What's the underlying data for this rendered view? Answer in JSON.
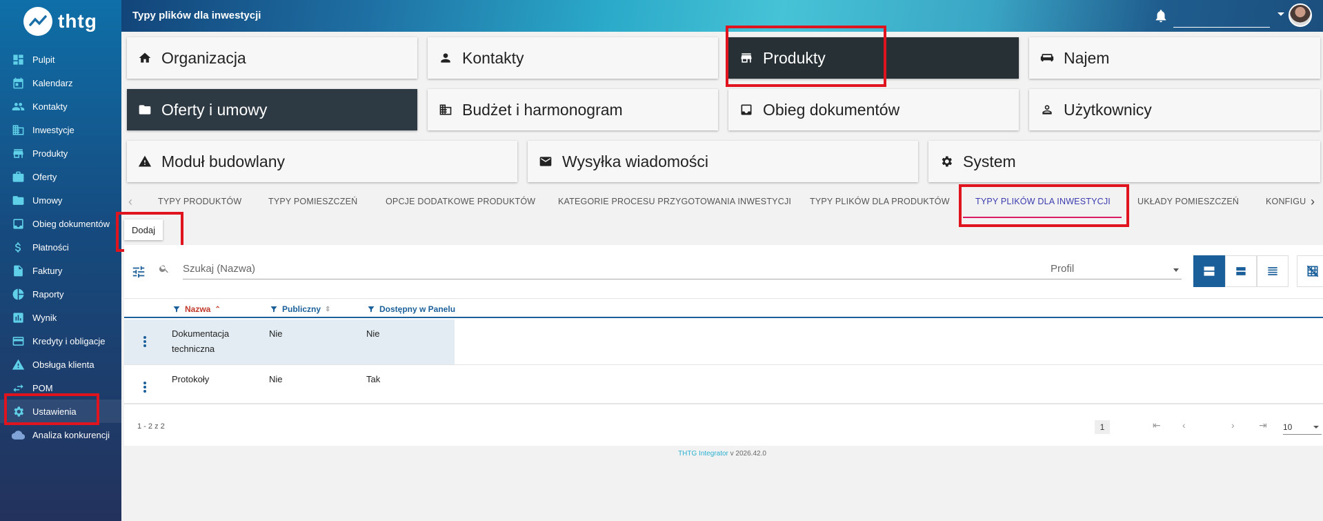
{
  "app": {
    "logo_text": "thtg"
  },
  "header": {
    "title": "Typy plików dla inwestycji"
  },
  "sidebar": {
    "items": [
      {
        "label": "Pulpit",
        "icon": "dashboard-icon"
      },
      {
        "label": "Kalendarz",
        "icon": "calendar-icon"
      },
      {
        "label": "Kontakty",
        "icon": "people-icon"
      },
      {
        "label": "Inwestycje",
        "icon": "building-icon"
      },
      {
        "label": "Produkty",
        "icon": "store-icon"
      },
      {
        "label": "Oferty",
        "icon": "briefcase-icon"
      },
      {
        "label": "Umowy",
        "icon": "folder-icon"
      },
      {
        "label": "Obieg dokumentów",
        "icon": "inbox-icon"
      },
      {
        "label": "Płatności",
        "icon": "dollar-icon"
      },
      {
        "label": "Faktury",
        "icon": "file-icon"
      },
      {
        "label": "Raporty",
        "icon": "pie-chart-icon"
      },
      {
        "label": "Wynik",
        "icon": "bar-chart-icon"
      },
      {
        "label": "Kredyty i obligacje",
        "icon": "credit-card-icon"
      },
      {
        "label": "Obsługa klienta",
        "icon": "warning-icon"
      },
      {
        "label": "POM",
        "icon": "arrows-icon"
      },
      {
        "label": "Ustawienia",
        "icon": "gear-icon"
      },
      {
        "label": "Analiza konkurencji",
        "icon": "cloud-icon"
      }
    ],
    "active": "Ustawienia"
  },
  "modules": {
    "row1": [
      {
        "label": "Organizacja",
        "icon": "home-icon"
      },
      {
        "label": "Kontakty",
        "icon": "person-icon"
      },
      {
        "label": "Produkty",
        "icon": "store-icon"
      },
      {
        "label": "Najem",
        "icon": "sofa-icon"
      }
    ],
    "row2": [
      {
        "label": "Oferty i umowy",
        "icon": "folder-icon"
      },
      {
        "label": "Budżet i harmonogram",
        "icon": "building-icon"
      },
      {
        "label": "Obieg dokumentów",
        "icon": "inbox-icon"
      },
      {
        "label": "Użytkownicy",
        "icon": "person-outline-icon"
      }
    ],
    "row3": [
      {
        "label": "Moduł budowlany",
        "icon": "warning-icon"
      },
      {
        "label": "Wysyłka wiadomości",
        "icon": "mail-icon"
      },
      {
        "label": "System",
        "icon": "gear-icon"
      }
    ]
  },
  "tabs": [
    "TYPY PRODUKTÓW",
    "TYPY POMIESZCZEŃ",
    "OPCJE DODATKOWE PRODUKTÓW",
    "KATEGORIE PROCESU PRZYGOTOWANIA INWESTYCJI",
    "TYPY PLIKÓW DLA PRODUKTÓW",
    "TYPY PLIKÓW DLA INWESTYCJI",
    "UKŁADY POMIESZCZEŃ",
    "KONFIGU"
  ],
  "active_tab": "TYPY PLIKÓW DLA INWESTYCJI",
  "add_button": "Dodaj",
  "search": {
    "placeholder": "Szukaj (Nazwa)",
    "value": ""
  },
  "profile_select": {
    "label": "Profil"
  },
  "table": {
    "columns": [
      "Nazwa",
      "Publiczny",
      "Dostępny w Panelu"
    ],
    "rows": [
      {
        "nazwa": "Dokumentacja techniczna",
        "publiczny": "Nie",
        "panel": "Nie"
      },
      {
        "nazwa": "Protokoły",
        "publiczny": "Nie",
        "panel": "Tak"
      }
    ]
  },
  "pagination": {
    "range": "1 - 2 z 2",
    "page": "1",
    "per_page": "10"
  },
  "footer": {
    "brand": "THTG Integrator",
    "version": "v 2026.42.0"
  },
  "colors": {
    "accent": "#1a5f9a",
    "highlight": "#e0141e",
    "active_tab": "#3b3bb0",
    "tab_underline": "#d81b60"
  }
}
